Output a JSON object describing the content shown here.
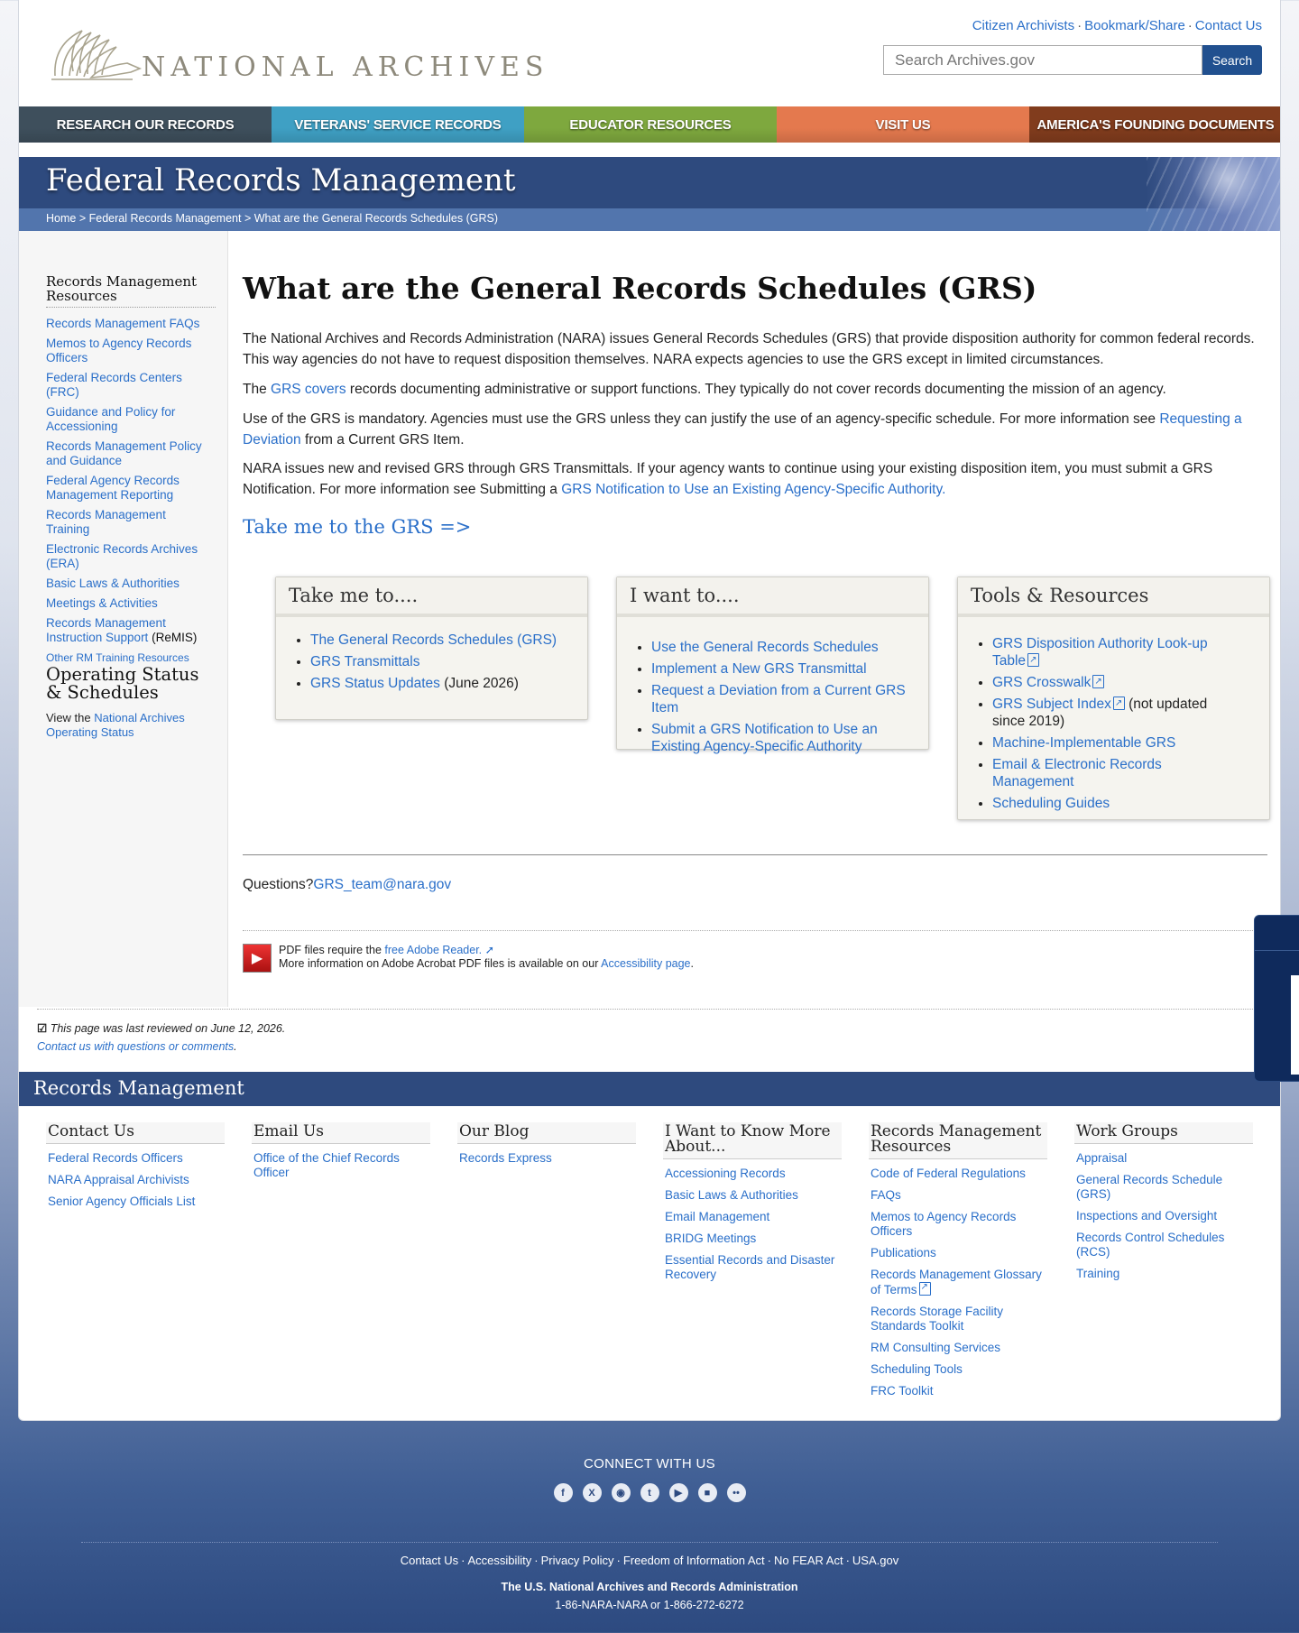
{
  "header": {
    "logo_text": "NATIONAL ARCHIVES",
    "util_links": [
      "Citizen Archivists",
      "Bookmark/Share",
      "Contact Us"
    ],
    "search_placeholder": "Search Archives.gov",
    "search_button": "Search"
  },
  "nav": [
    {
      "label": "Research Our Records",
      "color": "#3e4f5c"
    },
    {
      "label": "Veterans' Service Records",
      "color": "#3fa0c4"
    },
    {
      "label": "Educator Resources",
      "color": "#7ea83e"
    },
    {
      "label": "Visit Us",
      "color": "#e4794e"
    },
    {
      "label": "America's Founding Documents",
      "color": "#813c1d"
    }
  ],
  "banner": {
    "title": "Federal Records Management",
    "breadcrumb": [
      "Home",
      "Federal Records Management",
      "What are the General Records Schedules (GRS)"
    ]
  },
  "sidebar": {
    "resources_heading": "Records Management Resources",
    "links": [
      "Records Management FAQs",
      "Memos to Agency Records Officers",
      "Federal Records Centers (FRC)",
      "Guidance and Policy for Accessioning",
      "Records Management Policy and Guidance",
      "Federal Agency Records Management Reporting",
      "Records Management Training",
      "Electronic Records Archives (ERA)",
      "Basic Laws & Authorities",
      "Meetings & Activities",
      "Records Management Instruction Support"
    ],
    "remis_suffix": "(ReMIS)",
    "other_link": "Other RM Training Resources",
    "status_heading": "Operating Status & Schedules",
    "status_prefix": "View the",
    "status_link": "National Archives Operating Status"
  },
  "main": {
    "title": "What are the General Records Schedules (GRS)",
    "p1": "The National Archives and Records Administration (NARA) issues General Records Schedules (GRS) that provide disposition authority for common federal records. This way agencies do not have to request disposition themselves. NARA expects agencies to use the GRS except in limited circumstances.",
    "p2_pre": "The",
    "p2_link": "GRS covers",
    "p2_post": "records documenting administrative or support functions. They typically do not cover records documenting the mission of an agency.",
    "p3_pre": "Use of the GRS is mandatory. Agencies must use the GRS unless they can justify the use of an agency-specific schedule. For more information see",
    "p3_link": "Requesting a Deviation",
    "p3_post": "from a Current GRS Item.",
    "p4_pre": "NARA issues new and revised GRS through GRS Transmittals. If your agency wants to continue using your existing disposition item, you must submit a GRS Notification. For more information see Submitting a",
    "p4_link": "GRS Notification to Use an Existing Agency-Specific Authority.",
    "take_me_link": "Take me to the GRS =>",
    "boxes": {
      "take_me": {
        "title": "Take me to....",
        "items": [
          "The General Records Schedules (GRS)",
          "GRS Transmittals",
          "GRS Status Updates"
        ],
        "status_suffix": "(June 2026)"
      },
      "i_want": {
        "title": "I want to....",
        "items": [
          "Use the General Records Schedules",
          "Implement a New GRS Transmittal",
          "Request a Deviation from a Current GRS Item",
          "Submit a GRS Notification to Use an Existing Agency-Specific Authority"
        ]
      },
      "tools": {
        "title": "Tools & Resources",
        "items": [
          "GRS Disposition Authority Look-up Table",
          "GRS Crosswalk",
          "GRS Subject Index",
          "Machine-Implementable GRS",
          "Email & Electronic Records Management",
          "Scheduling Guides"
        ],
        "subject_suffix": "(not updated since 2019)"
      }
    },
    "questions_label": "Questions?",
    "questions_email": "GRS_team@nara.gov",
    "pdf_line1_pre": "PDF files require the",
    "pdf_line1_link": "free Adobe Reader.",
    "pdf_line2_pre": "More information on Adobe Acrobat PDF files is available on our",
    "pdf_line2_link": "Accessibility page",
    "pdf_line2_post": "."
  },
  "review": {
    "reviewed": "This page was last reviewed on June 12, 2026.",
    "contact": "Contact us with questions or comments"
  },
  "footer": {
    "band_title": "Records Management",
    "columns": [
      {
        "title": "Contact Us",
        "links": [
          "Federal Records Officers",
          "NARA Appraisal Archivists",
          "Senior Agency Officials List"
        ]
      },
      {
        "title": "Email Us",
        "links": [
          "Office of the Chief Records Officer"
        ]
      },
      {
        "title": "Our Blog",
        "links": [
          "Records Express"
        ]
      },
      {
        "title": "I Want to Know More About...",
        "links": [
          "Accessioning Records",
          "Basic Laws & Authorities",
          "Email Management",
          "BRIDG Meetings",
          "Essential Records and Disaster Recovery"
        ]
      },
      {
        "title": "Records Management Resources",
        "links": [
          "Code of Federal Regulations",
          "FAQs",
          "Memos to Agency Records Officers",
          "Publications",
          "Records Management Glossary of Terms",
          "Records Storage Facility Standards Toolkit",
          "RM Consulting Services",
          "Scheduling Tools",
          "FRC Toolkit"
        ]
      },
      {
        "title": "Work Groups",
        "links": [
          "Appraisal",
          "General Records Schedule (GRS)",
          "Inspections and Oversight",
          "Records Control Schedules (RCS)",
          "Training"
        ]
      }
    ]
  },
  "bottom": {
    "connect": "CONNECT WITH US",
    "social_icons": [
      "facebook-icon",
      "x-icon",
      "instagram-icon",
      "tumblr-icon",
      "youtube-icon",
      "blog-icon",
      "flickr-icon"
    ],
    "links": [
      "Contact Us",
      "Accessibility",
      "Privacy Policy",
      "Freedom of Information Act",
      "No FEAR Act",
      "USA.gov"
    ],
    "nara": "The U.S. National Archives and Records Administration",
    "phone": "1-86-NARA-NARA or 1-866-272-6272"
  }
}
